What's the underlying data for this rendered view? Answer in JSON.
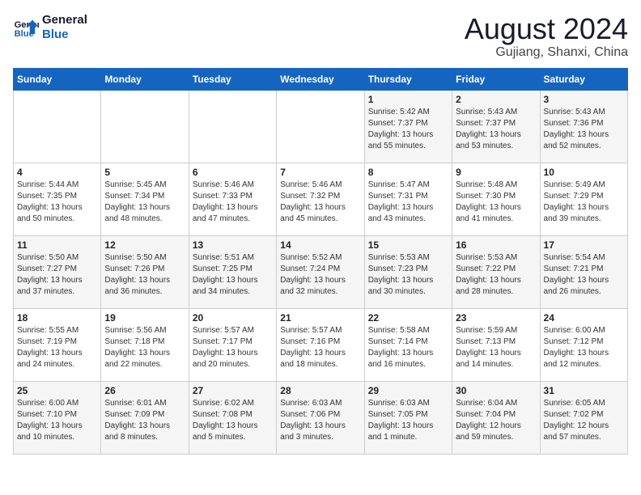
{
  "header": {
    "logo_line1": "General",
    "logo_line2": "Blue",
    "main_title": "August 2024",
    "subtitle": "Gujiang, Shanxi, China"
  },
  "calendar": {
    "days_of_week": [
      "Sunday",
      "Monday",
      "Tuesday",
      "Wednesday",
      "Thursday",
      "Friday",
      "Saturday"
    ],
    "weeks": [
      [
        {
          "day": "",
          "info": ""
        },
        {
          "day": "",
          "info": ""
        },
        {
          "day": "",
          "info": ""
        },
        {
          "day": "",
          "info": ""
        },
        {
          "day": "1",
          "info": "Sunrise: 5:42 AM\nSunset: 7:37 PM\nDaylight: 13 hours\nand 55 minutes."
        },
        {
          "day": "2",
          "info": "Sunrise: 5:43 AM\nSunset: 7:37 PM\nDaylight: 13 hours\nand 53 minutes."
        },
        {
          "day": "3",
          "info": "Sunrise: 5:43 AM\nSunset: 7:36 PM\nDaylight: 13 hours\nand 52 minutes."
        }
      ],
      [
        {
          "day": "4",
          "info": "Sunrise: 5:44 AM\nSunset: 7:35 PM\nDaylight: 13 hours\nand 50 minutes."
        },
        {
          "day": "5",
          "info": "Sunrise: 5:45 AM\nSunset: 7:34 PM\nDaylight: 13 hours\nand 48 minutes."
        },
        {
          "day": "6",
          "info": "Sunrise: 5:46 AM\nSunset: 7:33 PM\nDaylight: 13 hours\nand 47 minutes."
        },
        {
          "day": "7",
          "info": "Sunrise: 5:46 AM\nSunset: 7:32 PM\nDaylight: 13 hours\nand 45 minutes."
        },
        {
          "day": "8",
          "info": "Sunrise: 5:47 AM\nSunset: 7:31 PM\nDaylight: 13 hours\nand 43 minutes."
        },
        {
          "day": "9",
          "info": "Sunrise: 5:48 AM\nSunset: 7:30 PM\nDaylight: 13 hours\nand 41 minutes."
        },
        {
          "day": "10",
          "info": "Sunrise: 5:49 AM\nSunset: 7:29 PM\nDaylight: 13 hours\nand 39 minutes."
        }
      ],
      [
        {
          "day": "11",
          "info": "Sunrise: 5:50 AM\nSunset: 7:27 PM\nDaylight: 13 hours\nand 37 minutes."
        },
        {
          "day": "12",
          "info": "Sunrise: 5:50 AM\nSunset: 7:26 PM\nDaylight: 13 hours\nand 36 minutes."
        },
        {
          "day": "13",
          "info": "Sunrise: 5:51 AM\nSunset: 7:25 PM\nDaylight: 13 hours\nand 34 minutes."
        },
        {
          "day": "14",
          "info": "Sunrise: 5:52 AM\nSunset: 7:24 PM\nDaylight: 13 hours\nand 32 minutes."
        },
        {
          "day": "15",
          "info": "Sunrise: 5:53 AM\nSunset: 7:23 PM\nDaylight: 13 hours\nand 30 minutes."
        },
        {
          "day": "16",
          "info": "Sunrise: 5:53 AM\nSunset: 7:22 PM\nDaylight: 13 hours\nand 28 minutes."
        },
        {
          "day": "17",
          "info": "Sunrise: 5:54 AM\nSunset: 7:21 PM\nDaylight: 13 hours\nand 26 minutes."
        }
      ],
      [
        {
          "day": "18",
          "info": "Sunrise: 5:55 AM\nSunset: 7:19 PM\nDaylight: 13 hours\nand 24 minutes."
        },
        {
          "day": "19",
          "info": "Sunrise: 5:56 AM\nSunset: 7:18 PM\nDaylight: 13 hours\nand 22 minutes."
        },
        {
          "day": "20",
          "info": "Sunrise: 5:57 AM\nSunset: 7:17 PM\nDaylight: 13 hours\nand 20 minutes."
        },
        {
          "day": "21",
          "info": "Sunrise: 5:57 AM\nSunset: 7:16 PM\nDaylight: 13 hours\nand 18 minutes."
        },
        {
          "day": "22",
          "info": "Sunrise: 5:58 AM\nSunset: 7:14 PM\nDaylight: 13 hours\nand 16 minutes."
        },
        {
          "day": "23",
          "info": "Sunrise: 5:59 AM\nSunset: 7:13 PM\nDaylight: 13 hours\nand 14 minutes."
        },
        {
          "day": "24",
          "info": "Sunrise: 6:00 AM\nSunset: 7:12 PM\nDaylight: 13 hours\nand 12 minutes."
        }
      ],
      [
        {
          "day": "25",
          "info": "Sunrise: 6:00 AM\nSunset: 7:10 PM\nDaylight: 13 hours\nand 10 minutes."
        },
        {
          "day": "26",
          "info": "Sunrise: 6:01 AM\nSunset: 7:09 PM\nDaylight: 13 hours\nand 8 minutes."
        },
        {
          "day": "27",
          "info": "Sunrise: 6:02 AM\nSunset: 7:08 PM\nDaylight: 13 hours\nand 5 minutes."
        },
        {
          "day": "28",
          "info": "Sunrise: 6:03 AM\nSunset: 7:06 PM\nDaylight: 13 hours\nand 3 minutes."
        },
        {
          "day": "29",
          "info": "Sunrise: 6:03 AM\nSunset: 7:05 PM\nDaylight: 13 hours\nand 1 minute."
        },
        {
          "day": "30",
          "info": "Sunrise: 6:04 AM\nSunset: 7:04 PM\nDaylight: 12 hours\nand 59 minutes."
        },
        {
          "day": "31",
          "info": "Sunrise: 6:05 AM\nSunset: 7:02 PM\nDaylight: 12 hours\nand 57 minutes."
        }
      ]
    ]
  }
}
